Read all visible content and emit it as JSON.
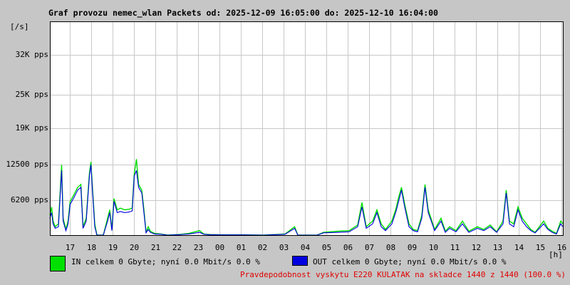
{
  "header": {
    "title": "Graf provozu nemec_wlan Packets od: 2025-12-09 16:05:00 do: 2025-12-10 16:04:00"
  },
  "chart_data": {
    "type": "area",
    "unit_label": "[/s]",
    "x_unit_label": "[h]",
    "y_ticks": [
      {
        "label": "6200 pps",
        "value": 6200
      },
      {
        "label": "12500 pps",
        "value": 12500
      },
      {
        "label": "19K pps",
        "value": 19000
      },
      {
        "label": "25K pps",
        "value": 25000
      },
      {
        "label": "32K pps",
        "value": 32000
      }
    ],
    "ylim": [
      0,
      38000
    ],
    "x_ticks": [
      "17",
      "18",
      "19",
      "20",
      "21",
      "22",
      "23",
      "00",
      "01",
      "02",
      "03",
      "04",
      "05",
      "06",
      "07",
      "08",
      "09",
      "10",
      "11",
      "12",
      "13",
      "14",
      "15",
      "16"
    ],
    "x_hours_since_start": [
      0.92,
      1.92,
      2.92,
      3.92,
      4.92,
      5.92,
      6.92,
      7.92,
      8.92,
      9.92,
      10.92,
      11.92,
      12.92,
      13.92,
      14.92,
      15.92,
      16.92,
      17.92,
      18.92,
      19.92,
      20.92,
      21.92,
      22.92,
      23.92
    ],
    "xlim_hours": [
      0,
      24
    ],
    "grid": true,
    "colors": {
      "in": "#00e000",
      "out": "#0000e0",
      "grid": "#c8c8c8",
      "background": "#ffffff"
    },
    "series": [
      {
        "name": "IN",
        "points": [
          [
            0.0,
            3500
          ],
          [
            0.08,
            5000
          ],
          [
            0.15,
            2500
          ],
          [
            0.25,
            1500
          ],
          [
            0.4,
            2000
          ],
          [
            0.55,
            12500
          ],
          [
            0.62,
            3000
          ],
          [
            0.75,
            1000
          ],
          [
            0.85,
            2500
          ],
          [
            0.95,
            6000
          ],
          [
            1.1,
            7000
          ],
          [
            1.3,
            8500
          ],
          [
            1.45,
            9000
          ],
          [
            1.55,
            1500
          ],
          [
            1.7,
            3000
          ],
          [
            1.85,
            11000
          ],
          [
            1.92,
            13000
          ],
          [
            2.0,
            8000
          ],
          [
            2.1,
            2000
          ],
          [
            2.2,
            0
          ],
          [
            2.5,
            0
          ],
          [
            2.7,
            3000
          ],
          [
            2.8,
            4500
          ],
          [
            2.9,
            1000
          ],
          [
            3.0,
            6500
          ],
          [
            3.15,
            4500
          ],
          [
            3.3,
            4800
          ],
          [
            3.5,
            4500
          ],
          [
            3.7,
            4600
          ],
          [
            3.85,
            4800
          ],
          [
            3.95,
            11000
          ],
          [
            4.05,
            13500
          ],
          [
            4.15,
            9000
          ],
          [
            4.3,
            8000
          ],
          [
            4.4,
            4500
          ],
          [
            4.5,
            500
          ],
          [
            4.6,
            1500
          ],
          [
            4.7,
            700
          ],
          [
            4.9,
            300
          ],
          [
            5.2,
            200
          ],
          [
            5.5,
            0
          ],
          [
            6,
            100
          ],
          [
            6.5,
            300
          ],
          [
            7,
            800
          ],
          [
            7.2,
            200
          ],
          [
            7.5,
            100
          ],
          [
            8,
            50
          ],
          [
            9,
            50
          ],
          [
            10,
            0
          ],
          [
            11,
            200
          ],
          [
            11.45,
            1500
          ],
          [
            11.6,
            0
          ],
          [
            12.5,
            0
          ],
          [
            12.8,
            500
          ],
          [
            13.5,
            700
          ],
          [
            14.0,
            800
          ],
          [
            14.4,
            1800
          ],
          [
            14.6,
            5800
          ],
          [
            14.8,
            1500
          ],
          [
            15.1,
            2500
          ],
          [
            15.3,
            4500
          ],
          [
            15.5,
            2000
          ],
          [
            15.7,
            1000
          ],
          [
            16.0,
            2500
          ],
          [
            16.2,
            4800
          ],
          [
            16.3,
            6500
          ],
          [
            16.45,
            8500
          ],
          [
            16.6,
            5500
          ],
          [
            16.8,
            2000
          ],
          [
            17.0,
            1000
          ],
          [
            17.2,
            800
          ],
          [
            17.4,
            3500
          ],
          [
            17.55,
            9000
          ],
          [
            17.7,
            4500
          ],
          [
            18.0,
            1000
          ],
          [
            18.3,
            3000
          ],
          [
            18.5,
            700
          ],
          [
            18.7,
            1500
          ],
          [
            19.0,
            800
          ],
          [
            19.3,
            2500
          ],
          [
            19.6,
            700
          ],
          [
            20.0,
            1500
          ],
          [
            20.3,
            1000
          ],
          [
            20.6,
            1800
          ],
          [
            20.9,
            600
          ],
          [
            21.2,
            2500
          ],
          [
            21.35,
            8000
          ],
          [
            21.5,
            2500
          ],
          [
            21.7,
            2000
          ],
          [
            21.9,
            5000
          ],
          [
            22.1,
            3000
          ],
          [
            22.3,
            2000
          ],
          [
            22.5,
            1000
          ],
          [
            22.7,
            500
          ],
          [
            22.9,
            1500
          ],
          [
            23.1,
            2500
          ],
          [
            23.3,
            1200
          ],
          [
            23.5,
            700
          ],
          [
            23.7,
            300
          ],
          [
            23.9,
            2500
          ],
          [
            24.0,
            2000
          ]
        ]
      },
      {
        "name": "OUT",
        "points": [
          [
            0.0,
            3000
          ],
          [
            0.08,
            4000
          ],
          [
            0.15,
            2000
          ],
          [
            0.25,
            1200
          ],
          [
            0.4,
            1500
          ],
          [
            0.55,
            11500
          ],
          [
            0.62,
            2500
          ],
          [
            0.75,
            800
          ],
          [
            0.85,
            2000
          ],
          [
            0.95,
            5500
          ],
          [
            1.1,
            6500
          ],
          [
            1.3,
            8000
          ],
          [
            1.45,
            8500
          ],
          [
            1.55,
            1200
          ],
          [
            1.7,
            2500
          ],
          [
            1.85,
            10500
          ],
          [
            1.92,
            12500
          ],
          [
            2.0,
            7500
          ],
          [
            2.1,
            1500
          ],
          [
            2.2,
            0
          ],
          [
            2.5,
            0
          ],
          [
            2.7,
            2500
          ],
          [
            2.8,
            4000
          ],
          [
            2.9,
            800
          ],
          [
            3.0,
            6000
          ],
          [
            3.15,
            4000
          ],
          [
            3.3,
            4200
          ],
          [
            3.5,
            4000
          ],
          [
            3.7,
            4100
          ],
          [
            3.85,
            4300
          ],
          [
            3.95,
            10500
          ],
          [
            4.05,
            11500
          ],
          [
            4.15,
            8500
          ],
          [
            4.3,
            7500
          ],
          [
            4.4,
            4000
          ],
          [
            4.5,
            400
          ],
          [
            4.6,
            1000
          ],
          [
            4.7,
            500
          ],
          [
            4.9,
            200
          ],
          [
            5.2,
            150
          ],
          [
            5.5,
            0
          ],
          [
            6,
            80
          ],
          [
            6.5,
            200
          ],
          [
            7,
            500
          ],
          [
            7.2,
            150
          ],
          [
            7.5,
            80
          ],
          [
            8,
            40
          ],
          [
            9,
            40
          ],
          [
            10,
            0
          ],
          [
            11,
            150
          ],
          [
            11.45,
            1200
          ],
          [
            11.6,
            0
          ],
          [
            12.5,
            0
          ],
          [
            12.8,
            400
          ],
          [
            13.5,
            500
          ],
          [
            14.0,
            600
          ],
          [
            14.4,
            1500
          ],
          [
            14.6,
            5000
          ],
          [
            14.8,
            1200
          ],
          [
            15.1,
            2000
          ],
          [
            15.3,
            4000
          ],
          [
            15.5,
            1500
          ],
          [
            15.7,
            800
          ],
          [
            16.0,
            2000
          ],
          [
            16.2,
            4300
          ],
          [
            16.3,
            5800
          ],
          [
            16.45,
            8000
          ],
          [
            16.6,
            5000
          ],
          [
            16.8,
            1500
          ],
          [
            17.0,
            800
          ],
          [
            17.2,
            600
          ],
          [
            17.4,
            3000
          ],
          [
            17.55,
            8500
          ],
          [
            17.7,
            4000
          ],
          [
            18.0,
            800
          ],
          [
            18.3,
            2500
          ],
          [
            18.5,
            500
          ],
          [
            18.7,
            1200
          ],
          [
            19.0,
            600
          ],
          [
            19.3,
            2000
          ],
          [
            19.6,
            500
          ],
          [
            20.0,
            1200
          ],
          [
            20.3,
            800
          ],
          [
            20.6,
            1500
          ],
          [
            20.9,
            500
          ],
          [
            21.2,
            2000
          ],
          [
            21.35,
            7500
          ],
          [
            21.5,
            2000
          ],
          [
            21.7,
            1500
          ],
          [
            21.9,
            4500
          ],
          [
            22.1,
            2500
          ],
          [
            22.3,
            1500
          ],
          [
            22.5,
            800
          ],
          [
            22.7,
            400
          ],
          [
            22.9,
            1200
          ],
          [
            23.1,
            2000
          ],
          [
            23.3,
            1000
          ],
          [
            23.5,
            500
          ],
          [
            23.7,
            200
          ],
          [
            23.9,
            2000
          ],
          [
            24.0,
            1500
          ]
        ]
      }
    ]
  },
  "legend": {
    "in_text": "IN celkem 0 Gbyte; nyní   0.0 Mbit/s 0.0 %",
    "out_text": "OUT celkem 0 Gbyte; nyní   0.0 Mbit/s 0.0 %"
  },
  "footer": {
    "note": "Pravdepodobnost vyskytu E220 KULATAK na skladce 1440 z 1440 (100.0 %)"
  }
}
